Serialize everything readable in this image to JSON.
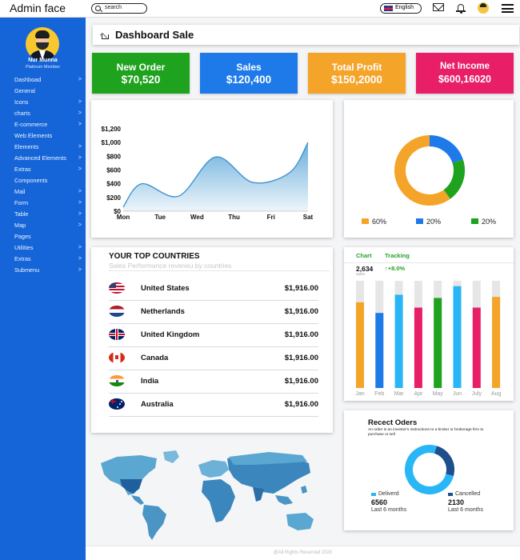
{
  "header": {
    "brand": "Admin face",
    "search_placeholder": "search",
    "language": "English"
  },
  "sidebar": {
    "user_name": "Nur Munna",
    "user_role": "Platinum Member",
    "items": [
      {
        "label": "Dashboad",
        "chevron": ">"
      },
      {
        "label": "General",
        "chevron": ""
      },
      {
        "label": "Icons",
        "chevron": ">"
      },
      {
        "label": "charts",
        "chevron": ">"
      },
      {
        "label": "E-commerce",
        "chevron": ">"
      },
      {
        "label": "Web Elements",
        "chevron": ""
      },
      {
        "label": "Elements",
        "chevron": ">"
      },
      {
        "label": "Advanced Elements",
        "chevron": ">"
      },
      {
        "label": "Extras",
        "chevron": ">"
      },
      {
        "label": "Components",
        "chevron": ""
      },
      {
        "label": "Mail",
        "chevron": ">"
      },
      {
        "label": "Form",
        "chevron": ">"
      },
      {
        "label": "Table",
        "chevron": ">"
      },
      {
        "label": "Map",
        "chevron": ">"
      },
      {
        "label": "Pages",
        "chevron": ""
      },
      {
        "label": "Utilities",
        "chevron": ">"
      },
      {
        "label": "Extras",
        "chevron": ">"
      },
      {
        "label": "Submenu",
        "chevron": ">"
      }
    ]
  },
  "page": {
    "title": "Dashboard Sale"
  },
  "stats": [
    {
      "label": "New Order",
      "value": "$70,520",
      "color": "#1fa31f"
    },
    {
      "label": "Sales",
      "value": "$120,400",
      "color": "#1e7ae8"
    },
    {
      "label": "Total Profit",
      "value": "$150,2000",
      "color": "#f5a42a"
    },
    {
      "label": "Net Income",
      "value": "$600,16020",
      "color": "#e81e66"
    }
  ],
  "chart_data": [
    {
      "type": "area",
      "categories": [
        "Mon",
        "Tue",
        "Wed",
        "Thu",
        "Fri",
        "Sat"
      ],
      "y_ticks": [
        "$0",
        "$200",
        "$400",
        "$600",
        "$800",
        "$1,000",
        "$1,200"
      ],
      "ylim": [
        0,
        1200
      ],
      "values": [
        60,
        400,
        220,
        790,
        420,
        560,
        1000
      ],
      "x_positions": [
        0,
        0.5,
        1.5,
        2.5,
        3.5,
        4.5,
        5
      ],
      "title": "",
      "xlabel": "",
      "ylabel": "",
      "fill_color": "#6aaedb"
    },
    {
      "type": "pie",
      "variant": "donut",
      "labels": [
        "60%",
        "20%",
        "20%"
      ],
      "values": [
        60,
        20,
        20
      ],
      "colors": [
        "#f5a42a",
        "#1e7ae8",
        "#1fa31f"
      ]
    },
    {
      "type": "bar",
      "categories": [
        "Jan",
        "Feb",
        "Mar",
        "Apr",
        "May",
        "Jun",
        "July",
        "Aug"
      ],
      "values": [
        80,
        70,
        87,
        75,
        84,
        95,
        75,
        85
      ],
      "ylim": [
        0,
        100
      ],
      "colors": [
        "#f5a42a",
        "#1e7ae8",
        "#29b6f6",
        "#e81e66",
        "#1fa31f",
        "#29b6f6",
        "#e81e66",
        "#f5a42a"
      ],
      "track_color": "#e6e6e6",
      "title": "",
      "xlabel": "",
      "ylabel": ""
    },
    {
      "type": "pie",
      "variant": "donut",
      "labels": [
        "Deliverd",
        "Cancelled"
      ],
      "values": [
        6560,
        2130
      ],
      "colors": [
        "#29b6f6",
        "#1e4e8c"
      ]
    }
  ],
  "countries": {
    "title": "YOUR TOP COUNTRIES",
    "subtitle": "Sales Performance reveneu by countries",
    "rows": [
      {
        "name": "United States",
        "value": "$1,916.00",
        "flag": "us-flag-icon"
      },
      {
        "name": "Netherlands",
        "value": "$1,916.00",
        "flag": "nl-flag-icon"
      },
      {
        "name": "United Kingdom",
        "value": "$1,916.00",
        "flag": "uk-flag-icon"
      },
      {
        "name": "Canada",
        "value": "$1,916.00",
        "flag": "ca-flag-icon"
      },
      {
        "name": "India",
        "value": "$1,916.00",
        "flag": "in-flag-icon"
      },
      {
        "name": "Australia",
        "value": "$1,916.00",
        "flag": "au-flag-icon"
      }
    ]
  },
  "tracking": {
    "tab1": "Chart",
    "tab2": "Tracking",
    "value": "2,634",
    "caption": "Sales",
    "delta": "↑+8.0%"
  },
  "orders": {
    "title": "Recect Oders",
    "description": "An order is an investor's instructions to a broker or brokerage firm to purchase or sell",
    "delivered_label": "Deliverd",
    "delivered_value": "6560",
    "delivered_caption": "Last 6 months",
    "cancelled_label": "Cancelled",
    "cancelled_value": "2130",
    "cancelled_caption": "Last 6 months"
  },
  "footer": "@All Rights Reserved 2020"
}
